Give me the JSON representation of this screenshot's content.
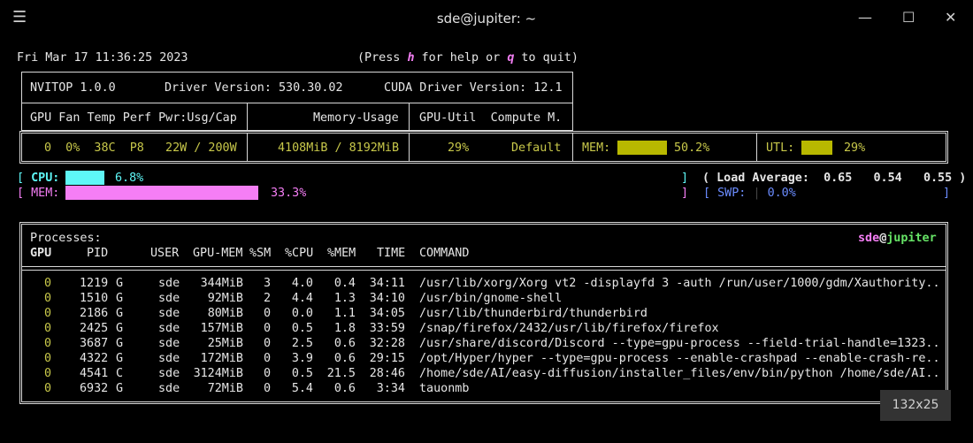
{
  "window": {
    "title": "sde@jupiter: ~",
    "menu_icon": "hamburger-icon",
    "minimize_icon": "minimize-icon",
    "maximize_icon": "maximize-icon",
    "close_icon": "close-icon"
  },
  "header": {
    "datetime": "Fri Mar 17 11:36:25 2023",
    "help_pre": "(Press ",
    "help_key": "h",
    "help_mid": " for help or ",
    "quit_key": "q",
    "help_post": " to quit)"
  },
  "gpu_table": {
    "nvitop_version": "NVITOP 1.0.0",
    "driver_version": "Driver Version: 530.30.02",
    "cuda_version": "CUDA Driver Version: 12.1",
    "headers": {
      "left": "GPU Fan Temp Perf Pwr:Usg/Cap",
      "mid": "Memory-Usage",
      "right": "GPU-Util  Compute M."
    },
    "row": {
      "left": "0  0%  38C  P8   22W / 200W",
      "mid": "4108MiB / 8192MiB",
      "util": "29%",
      "compute_mode": "Default"
    },
    "mem_label": "MEM:",
    "mem_percent": "50.2%",
    "mem_fraction": 0.502,
    "utl_label": "UTL:",
    "utl_percent": "29%",
    "utl_fraction": 0.29
  },
  "host": {
    "cpu_label": "CPU:",
    "cpu_percent": "6.8%",
    "cpu_fraction": 0.068,
    "mem_label": "MEM:",
    "mem_percent": "33.3%",
    "mem_fraction": 0.333,
    "load_label": "( Load Average:",
    "load_1": "0.65",
    "load_5": "0.54",
    "load_15": "0.55",
    "load_close": ")",
    "swp_label": "SWP:",
    "swp_percent": "0.0%"
  },
  "processes": {
    "title": "Processes:",
    "user": "sde",
    "at": "@",
    "host": "jupiter",
    "columns": {
      "gpu": "GPU",
      "pid": "PID",
      "user": "USER",
      "gpu_mem": "GPU-MEM",
      "sm": "%SM",
      "cpu": "%CPU",
      "mem": "%MEM",
      "time": "TIME",
      "command": "COMMAND"
    },
    "rows": [
      {
        "gpu": "0",
        "pid": "1219",
        "type": "G",
        "user": "sde",
        "gpu_mem": "344MiB",
        "sm": "3",
        "cpu": "4.0",
        "mem": "0.4",
        "time": "34:11",
        "command": "/usr/lib/xorg/Xorg vt2 -displayfd 3 -auth /run/user/1000/gdm/Xauthority.."
      },
      {
        "gpu": "0",
        "pid": "1510",
        "type": "G",
        "user": "sde",
        "gpu_mem": "92MiB",
        "sm": "2",
        "cpu": "4.4",
        "mem": "1.3",
        "time": "34:10",
        "command": "/usr/bin/gnome-shell"
      },
      {
        "gpu": "0",
        "pid": "2186",
        "type": "G",
        "user": "sde",
        "gpu_mem": "80MiB",
        "sm": "0",
        "cpu": "0.0",
        "mem": "1.1",
        "time": "34:05",
        "command": "/usr/lib/thunderbird/thunderbird"
      },
      {
        "gpu": "0",
        "pid": "2425",
        "type": "G",
        "user": "sde",
        "gpu_mem": "157MiB",
        "sm": "0",
        "cpu": "0.5",
        "mem": "1.8",
        "time": "33:59",
        "command": "/snap/firefox/2432/usr/lib/firefox/firefox"
      },
      {
        "gpu": "0",
        "pid": "3687",
        "type": "G",
        "user": "sde",
        "gpu_mem": "25MiB",
        "sm": "0",
        "cpu": "2.5",
        "mem": "0.6",
        "time": "32:28",
        "command": "/usr/share/discord/Discord --type=gpu-process --field-trial-handle=1323.."
      },
      {
        "gpu": "0",
        "pid": "4322",
        "type": "G",
        "user": "sde",
        "gpu_mem": "172MiB",
        "sm": "0",
        "cpu": "3.9",
        "mem": "0.6",
        "time": "29:15",
        "command": "/opt/Hyper/hyper --type=gpu-process --enable-crashpad --enable-crash-re.."
      },
      {
        "gpu": "0",
        "pid": "4541",
        "type": "C",
        "user": "sde",
        "gpu_mem": "3124MiB",
        "sm": "0",
        "cpu": "0.5",
        "mem": "21.5",
        "time": "28:46",
        "command": "/home/sde/AI/easy-diffusion/installer_files/env/bin/python /home/sde/AI.."
      },
      {
        "gpu": "0",
        "pid": "6932",
        "type": "G",
        "user": "sde",
        "gpu_mem": "72MiB",
        "sm": "0",
        "cpu": "5.4",
        "mem": "0.6",
        "time": "3:34",
        "command": "tauonmb"
      }
    ]
  },
  "terminal_size": "132x25",
  "colors": {
    "background": "#000000",
    "text": "#e6e6e6",
    "gpu_mem_bar": "#b8b800",
    "cpu_bar": "#5ef7f7",
    "mem_bar": "#f57ef5",
    "swp_color": "#6b8cff",
    "user_color": "#f57ef5",
    "host_color": "#66e366"
  }
}
